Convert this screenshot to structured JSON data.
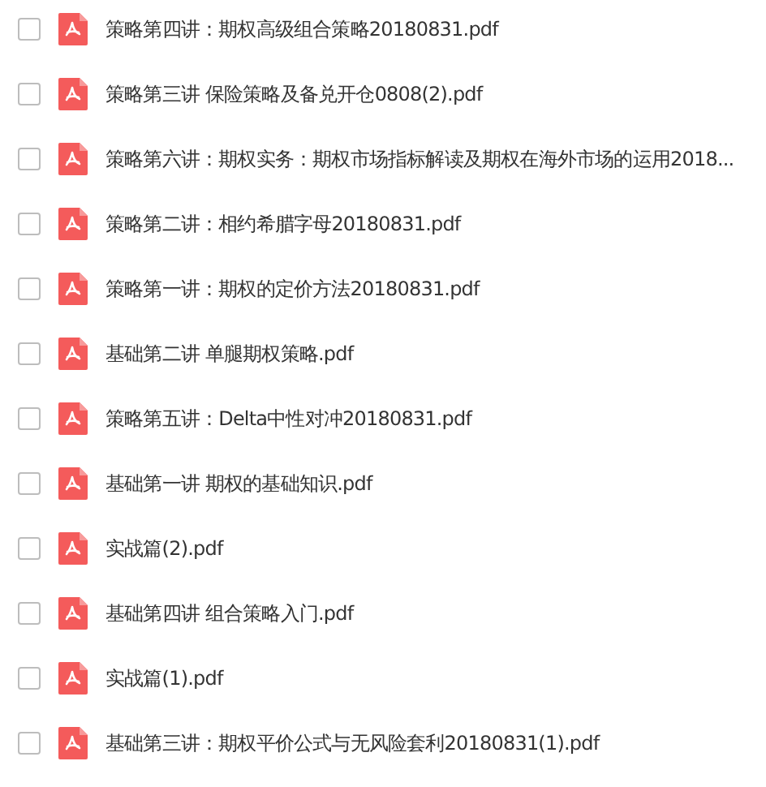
{
  "files": [
    {
      "name": "策略第四讲：期权高级组合策略20180831.pdf",
      "checked": false
    },
    {
      "name": "策略第三讲 保险策略及备兑开仓0808(2).pdf",
      "checked": false
    },
    {
      "name": "策略第六讲：期权实务：期权市场指标解读及期权在海外市场的运用2018...",
      "checked": false
    },
    {
      "name": "策略第二讲：相约希腊字母20180831.pdf",
      "checked": false
    },
    {
      "name": "策略第一讲：期权的定价方法20180831.pdf",
      "checked": false
    },
    {
      "name": "基础第二讲 单腿期权策略.pdf",
      "checked": false
    },
    {
      "name": "策略第五讲：Delta中性对冲20180831.pdf",
      "checked": false
    },
    {
      "name": "基础第一讲 期权的基础知识.pdf",
      "checked": false
    },
    {
      "name": "实战篇(2).pdf",
      "checked": false
    },
    {
      "name": "基础第四讲 组合策略入门.pdf",
      "checked": false
    },
    {
      "name": "实战篇(1).pdf",
      "checked": false
    },
    {
      "name": "基础第三讲：期权平价公式与无风险套利20180831(1).pdf",
      "checked": false
    }
  ]
}
